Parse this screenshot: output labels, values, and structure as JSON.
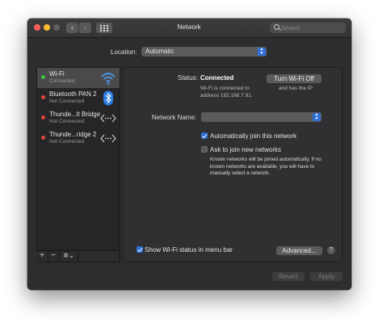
{
  "window": {
    "title": "Network",
    "search_placeholder": "Search",
    "nav_back": "‹",
    "nav_forward": "›"
  },
  "location": {
    "label": "Location:",
    "value": "Automatic"
  },
  "sidebar": {
    "items": [
      {
        "name": "Wi-Fi",
        "status": "Connected",
        "dot": "#3fbf3f",
        "icon": "wifi-icon",
        "selected": true
      },
      {
        "name": "Bluetooth PAN 2",
        "status": "Not Connected",
        "dot": "#e0443a",
        "icon": "bluetooth-icon",
        "selected": false
      },
      {
        "name": "Thunde...lt Bridge",
        "status": "Not Connected",
        "dot": "#e0443a",
        "icon": "thunderbolt-bridge-icon",
        "selected": false
      },
      {
        "name": "Thunde...ridge 2",
        "status": "Not Connected",
        "dot": "#e0443a",
        "icon": "thunderbolt-bridge-icon",
        "selected": false
      }
    ],
    "add_label": "+",
    "remove_label": "−",
    "action_label": "✲⌄"
  },
  "detail": {
    "status_label": "Status:",
    "status_value": "Connected",
    "turn_off_label": "Turn Wi-Fi Off",
    "status_desc": "Wi-Fi is connected to address 192.168.7.91.",
    "status_desc_right": "and has the IP",
    "network_name_label": "Network Name:",
    "auto_join_label": "Automatically join this network",
    "auto_join_checked": true,
    "ask_join_label": "Ask to join new networks",
    "ask_join_checked": false,
    "ask_join_desc": "Known networks will be joined automatically. If no known networks are available, you will have to manually select a network.",
    "menubar_label": "Show Wi-Fi status in menu bar",
    "menubar_checked": true,
    "advanced_label": "Advanced...",
    "help_label": "?"
  },
  "footer": {
    "revert_label": "Revert",
    "apply_label": "Apply"
  },
  "colors": {
    "accent": "#2f6fd8",
    "connected": "#3fbf3f",
    "not_connected": "#e0443a"
  }
}
